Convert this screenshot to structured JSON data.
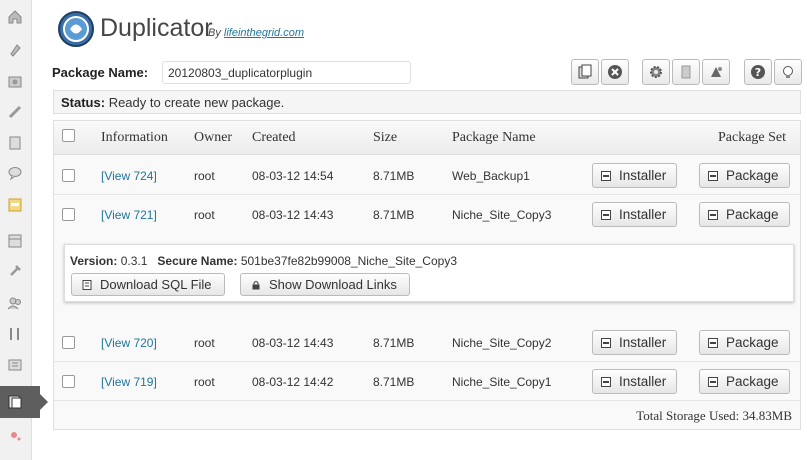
{
  "header": {
    "title": "Duplicator",
    "by_prefix": "By",
    "by_link": "lifeinthegrid.com"
  },
  "package": {
    "label": "Package Name:",
    "value": "20120803_duplicatorplugin"
  },
  "status": {
    "label": "Status:",
    "text": "Ready to create new package."
  },
  "table": {
    "columns": [
      "Information",
      "Owner",
      "Created",
      "Size",
      "Package Name",
      "Package Set"
    ],
    "rows": [
      {
        "info": "[View 724]",
        "owner": "root",
        "created": "08-03-12 14:54",
        "size": "8.71MB",
        "name": "Web_Backup1",
        "installer": "Installer",
        "package": "Package"
      },
      {
        "info": "[View 721]",
        "owner": "root",
        "created": "08-03-12 14:43",
        "size": "8.71MB",
        "name": "Niche_Site_Copy3",
        "installer": "Installer",
        "package": "Package"
      },
      {
        "info": "[View 720]",
        "owner": "root",
        "created": "08-03-12 14:43",
        "size": "8.71MB",
        "name": "Niche_Site_Copy2",
        "installer": "Installer",
        "package": "Package"
      },
      {
        "info": "[View 719]",
        "owner": "root",
        "created": "08-03-12 14:42",
        "size": "8.71MB",
        "name": "Niche_Site_Copy1",
        "installer": "Installer",
        "package": "Package"
      }
    ],
    "details": {
      "version_label": "Version:",
      "version": "0.3.1",
      "secure_label": "Secure Name:",
      "secure": "501be37fe82b99008_Niche_Site_Copy3",
      "download_sql": "Download SQL File",
      "show_links": "Show Download Links"
    },
    "total_storage": "Total Storage Used: 34.83MB"
  },
  "colors": {
    "link": "#21759b",
    "sidebar_active": "#5e5e5e"
  }
}
